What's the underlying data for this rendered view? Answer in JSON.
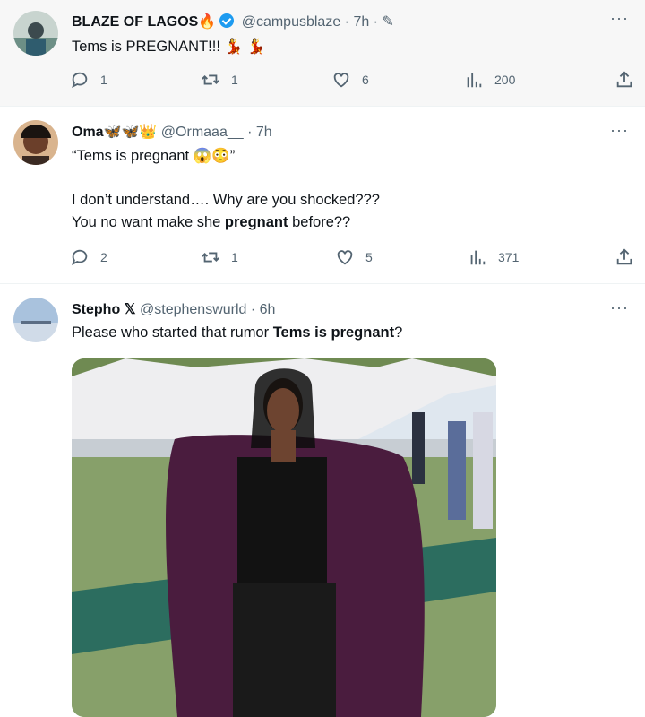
{
  "tweets": [
    {
      "name": "BLAZE OF LAGOS",
      "name_emoji": "🔥",
      "handle": "@campusblaze",
      "time": "7h",
      "text": "Tems is PREGNANT!!!",
      "text_emoji": "💃 💃",
      "replies": "1",
      "retweets": "1",
      "likes": "6",
      "views": "200"
    },
    {
      "name": "Oma",
      "name_emoji": "🦋🦋👑",
      "handle": "@Ormaaa__",
      "time": "7h",
      "line1": "“Tems is pregnant 😱😳”",
      "line2": "I don’t understand…. Why are you shocked???",
      "line3_pre": "You no want make she ",
      "line3_bold": "pregnant",
      "line3_post": " before??",
      "replies": "2",
      "retweets": "1",
      "likes": "5",
      "views": "371"
    },
    {
      "name": "Stepho",
      "handle": "@stephenswurld",
      "time": "6h",
      "text_pre": "Please who started that rumor ",
      "text_bold": "Tems is pregnant",
      "text_post": "?"
    }
  ],
  "icons": {
    "more": "more-icon",
    "reply": "reply-icon",
    "retweet": "retweet-icon",
    "like": "heart-icon",
    "views": "views-icon",
    "share": "share-icon",
    "verified": "verified-icon"
  }
}
